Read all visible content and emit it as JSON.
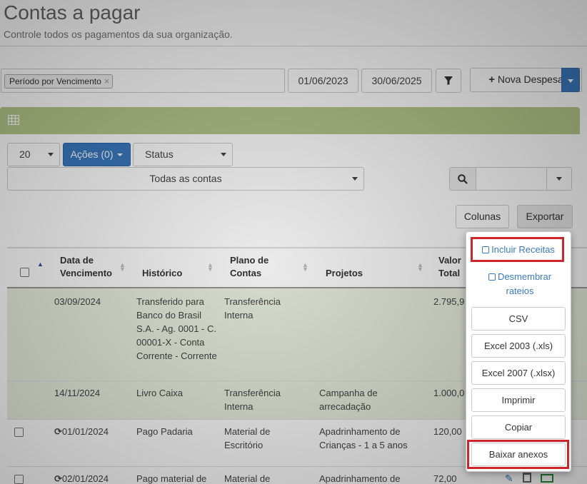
{
  "header": {
    "title": "Contas a pagar",
    "subtitle": "Controle todos os pagamentos da sua organização."
  },
  "filters": {
    "tag": "Período por Vencimento",
    "tag_remove": "×",
    "date_start": "01/06/2023",
    "date_end": "30/06/2025",
    "filter_icon": "filter-icon",
    "new_button": "Nova Despesa",
    "new_icon": "plus-icon"
  },
  "panel": {
    "icon": "table-grid-icon"
  },
  "controls": {
    "page_size": "20",
    "actions": "Ações (0)",
    "status": "Status",
    "accounts": "Todas as contas",
    "search_icon": "search-icon",
    "columns_button": "Colunas",
    "export_button": "Exportar"
  },
  "table": {
    "headers": [
      "Data de Vencimento",
      "Histórico",
      "Plano de Contas",
      "Projetos",
      "Valor Total"
    ],
    "rows": [
      {
        "date": "03/09/2024",
        "historico": "Transferido para Banco do Brasil S.A. - Ag. 0001 - C. 00001-X - Conta Corrente - Corrente",
        "plano": "Transferência Interna",
        "projeto": "",
        "valor": "2.795,9"
      },
      {
        "date": "14/11/2024",
        "historico": "Livro Caixa",
        "plano": "Transferência Interna",
        "projeto": "Campanha de arrecadação",
        "valor": "1.000,0"
      },
      {
        "date": "01/01/2024",
        "historico": "Pago Padaria",
        "plano": "Material de Escritório",
        "projeto": "Apadrinhamento de Crianças - 1 a 5 anos",
        "valor": "120,00"
      },
      {
        "date": "02/01/2024",
        "historico": "Pago material de",
        "plano": "Material de",
        "projeto": "Apadrinhamento de",
        "valor": "72,00"
      }
    ]
  },
  "export_menu": {
    "include_receitas": "Incluir Receitas",
    "desmembrar": "Desmembrar rateios",
    "csv": "CSV",
    "excel2003": "Excel 2003 (.xls)",
    "excel2007": "Excel 2007 (.xlsx)",
    "print": "Imprimir",
    "copy": "Copiar",
    "download": "Baixar anexos"
  }
}
